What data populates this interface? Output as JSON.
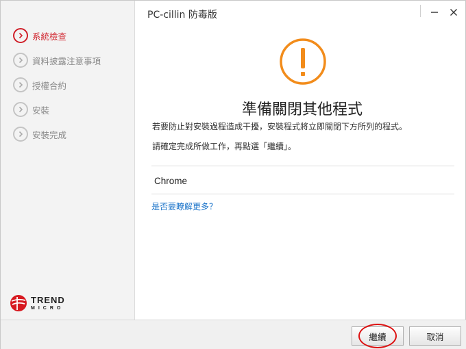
{
  "window": {
    "title": "PC-cillin 防毒版"
  },
  "sidebar": {
    "steps": [
      {
        "label": "系統檢查",
        "active": true
      },
      {
        "label": "資料披露注意事項",
        "active": false
      },
      {
        "label": "授權合約",
        "active": false
      },
      {
        "label": "安裝",
        "active": false
      },
      {
        "label": "安裝完成",
        "active": false
      }
    ],
    "logo": {
      "line1": "TREND",
      "line2": "MICRO"
    }
  },
  "main": {
    "heading": "準備關閉其他程式",
    "message1": "若要防止對安裝過程造成干擾，安裝程式將立即關閉下方所列的程式。",
    "message2": "請確定完成所做工作，再點選「繼續」。",
    "programs": [
      "Chrome"
    ],
    "learn_more": "是否要瞭解更多？"
  },
  "buttons": {
    "continue": "繼續",
    "cancel": "取消"
  },
  "colors": {
    "accent": "#d0202a",
    "warning": "#f28c1b",
    "link": "#1a73c9"
  },
  "icons": {
    "warning": "warning-icon",
    "step": "chevron-right-icon",
    "minimize": "minimize-icon",
    "close": "close-icon"
  }
}
